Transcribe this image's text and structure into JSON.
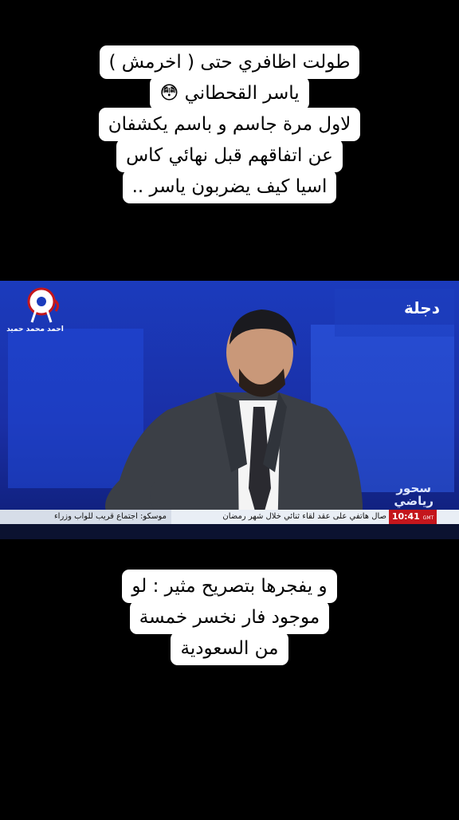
{
  "caption_top": {
    "lines": [
      "طولت اظافري حتى ( اخرمش )",
      "ياسر القحطاني 😳",
      "لاول مرة جاسم و باسم يكشفان",
      "عن اتفاقهم قبل نهائي كاس",
      "اسيا كيف يضربون ياسر .."
    ]
  },
  "video": {
    "channel_logo_text": "احمد محمد حميد",
    "broadcaster_logo": "دجلة",
    "program_logo": "سحور\nرياضي",
    "ticker_left": "موسكو: اجتماع قريب للواب وزراء",
    "ticker_right": "صال هاتفي على عقد لقاء ثنائي خلال شهر رمضان",
    "clock": "10:41",
    "clock_suffix": "GMT"
  },
  "caption_bottom": {
    "lines": [
      "و يفجرها بتصريح مثير : لو",
      "موجود فار نخسر خمسة",
      "من السعودية"
    ]
  },
  "colors": {
    "caption_bg": "#ffffff",
    "studio_blue": "#1b3bbd",
    "clock_red": "#c4161c"
  }
}
